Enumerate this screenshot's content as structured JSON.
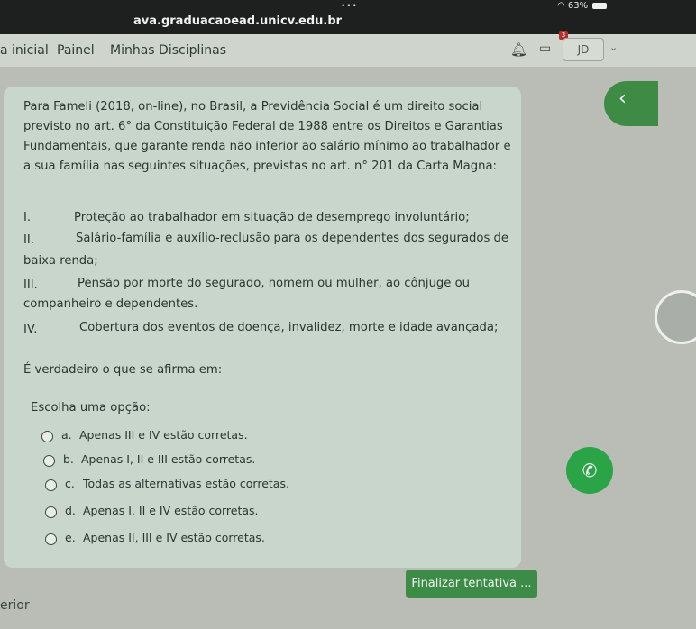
{
  "browser": {
    "dots": "•••",
    "url": "ava.graduacaoead.unicv.edu.br",
    "battery": "63%"
  },
  "nav": {
    "home": "a inicial",
    "dashboard": "Painel",
    "courses": "Minhas Disciplinas",
    "notification_count": "3",
    "user_initials": "JD"
  },
  "question": {
    "intro": [
      "Para Fameli (2018, on-line), no Brasil, a Previdência Social é um direito social",
      "previsto no art. 6° da Constituição Federal de 1988 entre os Direitos e Garantias",
      "Fundamentais, que garante renda não inferior ao salário mínimo ao trabalhador e",
      "a sua família nas seguintes situações, previstas no art. n° 201 da Carta Magna:"
    ],
    "items": [
      {
        "num": "I.",
        "text": "Proteção ao trabalhador em situação de desemprego involuntário;",
        "cont": ""
      },
      {
        "num": "II.",
        "text": "Salário-família e auxílio-reclusão para os dependentes dos segurados de",
        "cont": "baixa renda;"
      },
      {
        "num": "III.",
        "text": "Pensão por morte do segurado, homem ou mulher, ao cônjuge ou",
        "cont": "companheiro e dependentes."
      },
      {
        "num": "IV.",
        "text": "Cobertura dos eventos de doença, invalidez, morte e idade avançada;",
        "cont": ""
      }
    ],
    "statement": "É verdadeiro o que se afirma em:",
    "prompt": "Escolha uma opção:",
    "options": [
      {
        "letter": "a.",
        "text": "Apenas III e IV estão corretas."
      },
      {
        "letter": "b.",
        "text": "Apenas I, II e III estão corretas."
      },
      {
        "letter": "c.",
        "text": "Todas as alternativas estão corretas."
      },
      {
        "letter": "d.",
        "text": "Apenas I, II e IV estão corretas."
      },
      {
        "letter": "e.",
        "text": "Apenas II, III e IV estão corretas."
      }
    ]
  },
  "actions": {
    "finish": "Finalizar tentativa ...",
    "previous": "erior"
  },
  "colors": {
    "accent": "#3c8c47",
    "whatsapp": "#2aa447"
  }
}
